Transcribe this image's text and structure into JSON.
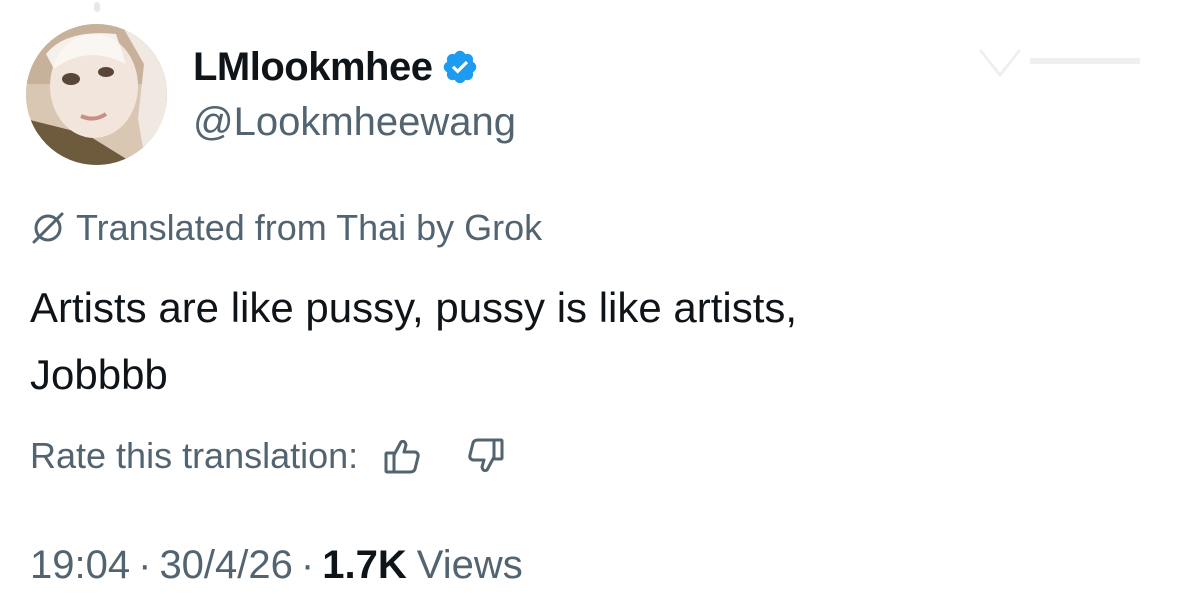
{
  "author": {
    "display_name": "LMlookmhee",
    "handle": "@Lookmheewang",
    "verified": true,
    "avatar_icon": "avatar-photo"
  },
  "translation": {
    "notice": "Translated from Thai by Grok",
    "icon": "grok-icon"
  },
  "tweet": {
    "text_line1": "Artists are like pussy, pussy is like artists,",
    "text_line2": "Jobbbb"
  },
  "rating": {
    "label": "Rate this translation:",
    "up_icon": "thumbs-up-icon",
    "down_icon": "thumbs-down-icon"
  },
  "meta": {
    "time": "19:04",
    "separator": "·",
    "date": "30/4/26",
    "views_count": "1.7K",
    "views_label": "Views"
  },
  "colors": {
    "text_primary": "#0f1419",
    "text_secondary": "#536471",
    "verified_blue": "#1d9bf0"
  }
}
